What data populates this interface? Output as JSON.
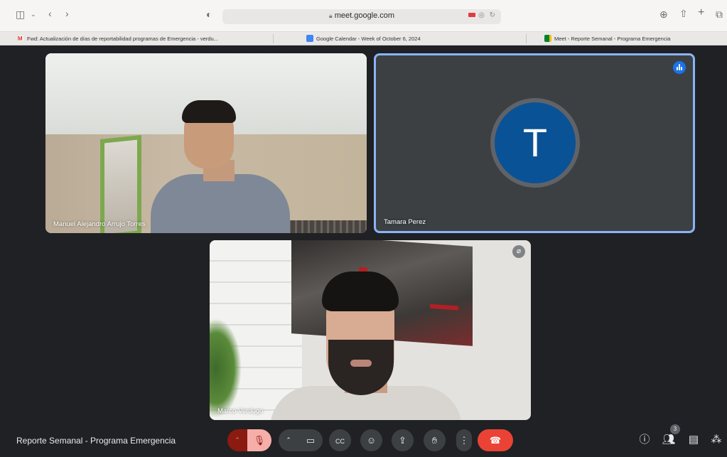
{
  "browser": {
    "url": "meet.google.com",
    "tabs": [
      {
        "title": "Fwd: Actualización de días de reportabilidad programas de Emergencia - verdu..."
      },
      {
        "title": "Google Calendar - Week of October 6, 2024"
      },
      {
        "title": "Meet - Reporte Semanal - Programa Emergencia"
      }
    ]
  },
  "participants": [
    {
      "name": "Manuel Alejandro Arrujo Torres"
    },
    {
      "name": "Tamara Perez",
      "avatar_letter": "T",
      "avatar_color": "#0a5296",
      "speaking": true
    },
    {
      "name": "Marco Verdugo",
      "muted": true
    }
  ],
  "meeting": {
    "title": "Reporte Semanal - Programa Emergencia",
    "participant_count": "3"
  },
  "colors": {
    "active_speaker_border": "#8ab4f8",
    "end_call": "#ea4335",
    "mic_muted": "#f6aea9"
  },
  "controls": {
    "icons": [
      "mic-off-icon",
      "camera-icon",
      "captions-icon",
      "emoji-icon",
      "present-icon",
      "raise-hand-icon",
      "more-options-icon",
      "end-call-icon"
    ],
    "right_icons": [
      "info-icon",
      "people-icon",
      "chat-icon",
      "activities-icon"
    ]
  }
}
